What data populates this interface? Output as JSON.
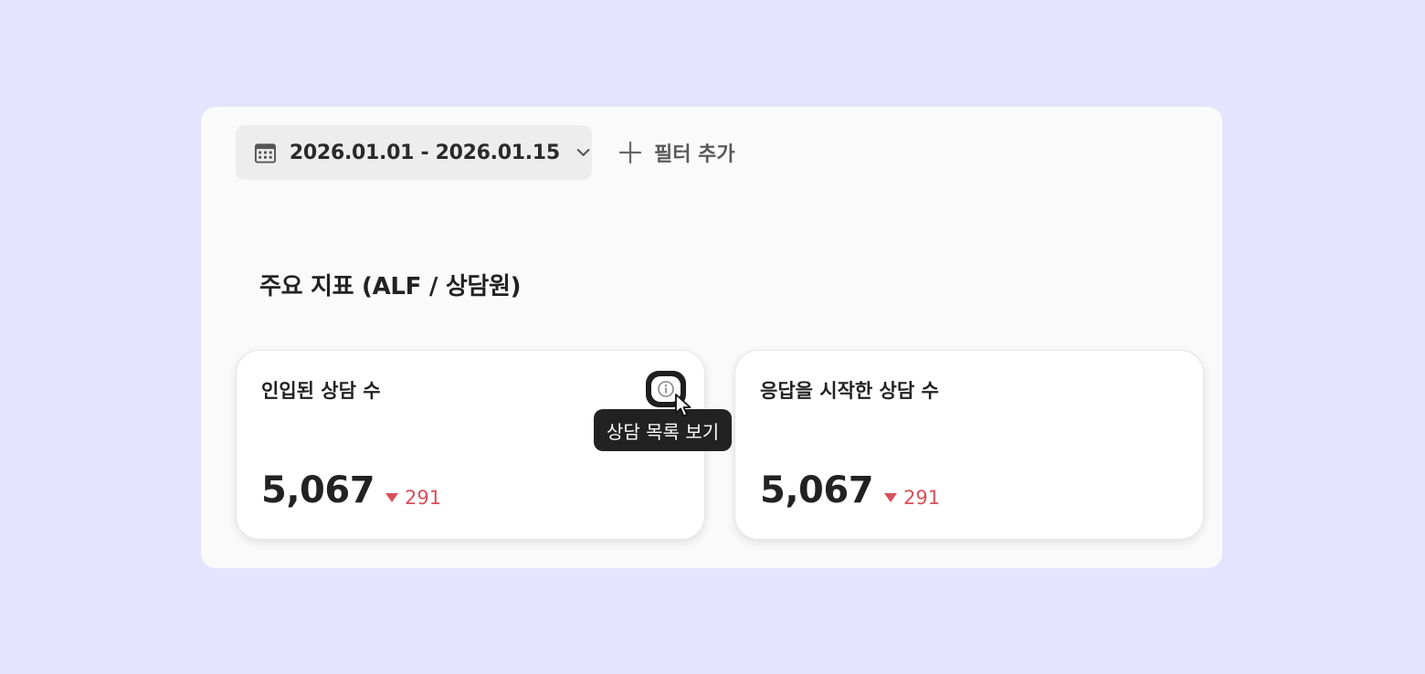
{
  "filters": {
    "date_range": "2026.01.01 - 2026.01.15",
    "date_icon": "calendar-icon",
    "dropdown_icon": "chevron-down-icon",
    "add_filter_icon": "plus-icon",
    "add_filter_label": "필터 추가"
  },
  "section": {
    "title": "주요 지표 (ALF / 상담원)"
  },
  "cards": [
    {
      "title": "인입된 상담 수",
      "value": "5,067",
      "delta": "291",
      "delta_direction": "down",
      "info_icon": "info-icon",
      "tooltip": "상담 목록 보기"
    },
    {
      "title": "응답을 시작한 상담 수",
      "value": "5,067",
      "delta": "291",
      "delta_direction": "down"
    }
  ],
  "colors": {
    "background": "#e5e4fe",
    "panel": "#fafafa",
    "delta_negative": "#d9505a",
    "tooltip_bg": "#222222"
  }
}
